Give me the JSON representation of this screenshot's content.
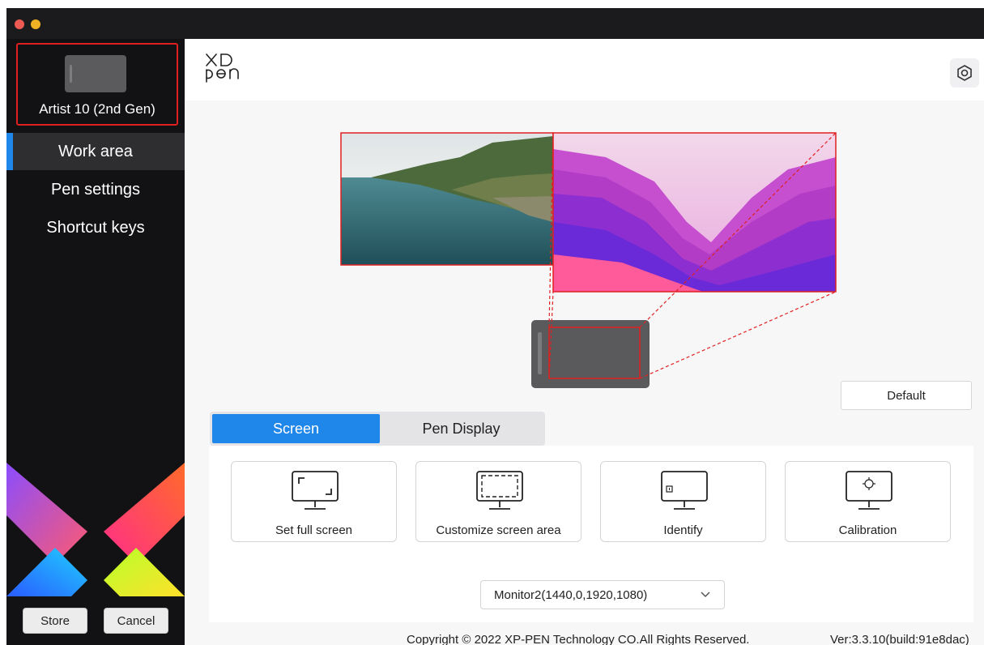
{
  "device": {
    "name": "Artist 10 (2nd Gen)"
  },
  "brand": {
    "line1": "XP",
    "line2": "pen"
  },
  "sidebar": {
    "items": [
      {
        "label": "Work area",
        "active": true
      },
      {
        "label": "Pen settings",
        "active": false
      },
      {
        "label": "Shortcut keys",
        "active": false
      }
    ],
    "store_label": "Store",
    "cancel_label": "Cancel"
  },
  "work_area": {
    "default_label": "Default",
    "tabs": [
      {
        "label": "Screen",
        "active": true
      },
      {
        "label": "Pen Display",
        "active": false
      }
    ],
    "options": [
      {
        "label": "Set full screen",
        "icon": "monitor-fullscreen-icon"
      },
      {
        "label": "Customize screen area",
        "icon": "monitor-custom-area-icon"
      },
      {
        "label": "Identify",
        "icon": "monitor-identify-icon"
      },
      {
        "label": "Calibration",
        "icon": "monitor-calibration-icon"
      }
    ],
    "monitor_select": {
      "value": "Monitor2(1440,0,1920,1080)"
    }
  },
  "footer": {
    "copyright": "Copyright © 2022  XP-PEN Technology CO.All Rights Reserved.",
    "version": "Ver:3.3.10(build:91e8dac)"
  },
  "colors": {
    "accent": "#1f86ea",
    "highlight": "#e02020",
    "sidebar_bg": "#121214"
  }
}
